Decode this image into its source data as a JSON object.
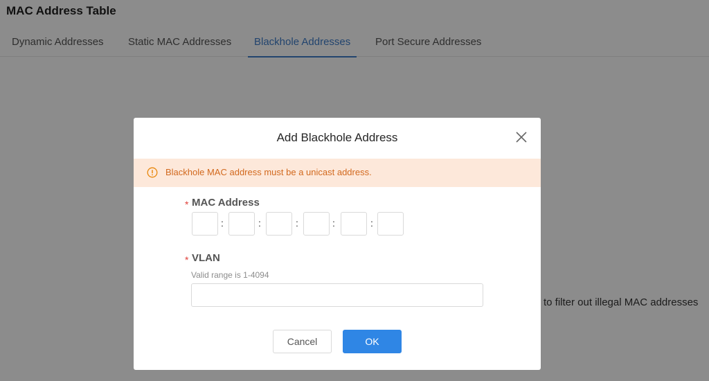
{
  "page": {
    "title": "MAC Address Table",
    "tabs": [
      {
        "label": "Dynamic Addresses",
        "active": false
      },
      {
        "label": "Static MAC Addresses",
        "active": false
      },
      {
        "label": "Blackhole Addresses",
        "active": true
      },
      {
        "label": "Port Secure Addresses",
        "active": false
      }
    ],
    "background_text": "to filter out illegal MAC addresses"
  },
  "dialog": {
    "title": "Add Blackhole Address",
    "close_icon": "close-icon",
    "alert": {
      "icon": "warning-circle-icon",
      "text": "Blackhole MAC address must be a unicast address.",
      "color": "#d2691e",
      "background": "#fde8da"
    },
    "mac_field": {
      "required_mark": "*",
      "label": "MAC Address",
      "separator": ":",
      "octets": [
        "",
        "",
        "",
        "",
        "",
        ""
      ]
    },
    "vlan_field": {
      "required_mark": "*",
      "label": "VLAN",
      "hint": "Valid range is 1-4094",
      "value": ""
    },
    "buttons": {
      "cancel": "Cancel",
      "ok": "OK"
    }
  },
  "colors": {
    "accent": "#2f86e5",
    "tab_active": "#3f7dc9",
    "required": "#e0403a"
  }
}
